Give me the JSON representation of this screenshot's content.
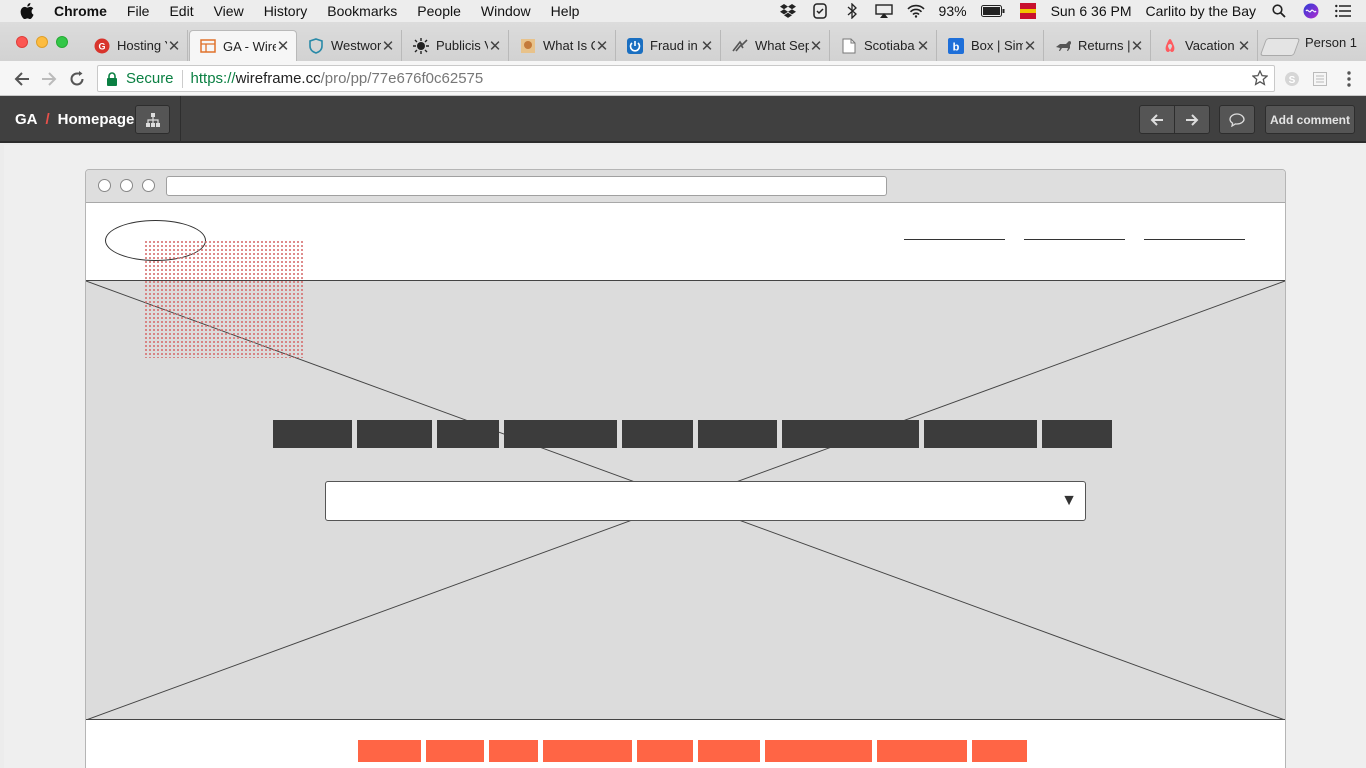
{
  "menubar": {
    "app_name": "Chrome",
    "items": [
      "File",
      "Edit",
      "View",
      "History",
      "Bookmarks",
      "People",
      "Window",
      "Help"
    ],
    "battery": "93%",
    "clock": "Sun 6 36 PM",
    "user": "Carlito by the Bay",
    "icons": [
      "dropbox-icon",
      "check-icon",
      "bluetooth-icon",
      "airplay-icon",
      "wifi-icon",
      "battery-icon",
      "flag-icon",
      "search-icon",
      "siri-icon",
      "list-icon"
    ]
  },
  "tabs": [
    {
      "title": "Hosting Y",
      "icon": "hosting-icon",
      "color": "#d8342c"
    },
    {
      "title": "GA - Wire",
      "icon": "wireframe-icon",
      "color": "#e0722b",
      "active": true
    },
    {
      "title": "Westworl",
      "icon": "shield-icon",
      "color": "#2a8aa8"
    },
    {
      "title": "Publicis V",
      "icon": "sun-icon",
      "color": "#222222"
    },
    {
      "title": "What Is C",
      "icon": "comic-icon",
      "color": "#c47a3a"
    },
    {
      "title": "Fraud in",
      "icon": "power-icon",
      "color": "#1a6fc1"
    },
    {
      "title": "What Sep",
      "icon": "wing-icon",
      "color": "#555555"
    },
    {
      "title": "Scotiaba",
      "icon": "page-icon",
      "color": "#777777"
    },
    {
      "title": "Box | Sim",
      "icon": "box-icon",
      "color": "#1e6fd9"
    },
    {
      "title": "Returns |",
      "icon": "dog-icon",
      "color": "#555555"
    },
    {
      "title": "Vacation",
      "icon": "airbnb-icon",
      "color": "#ff5a5f"
    }
  ],
  "profile_label": "Person 1",
  "omnibox": {
    "secure_label": "Secure",
    "scheme": "https://",
    "host": "wireframe.cc",
    "path": "/pro/pp/77e676f0c62575"
  },
  "appbar": {
    "project": "GA",
    "separator": "/",
    "page": "Homepage",
    "add_comment_label": "Add comment"
  },
  "wireframe": {
    "hero_button_count": 9,
    "footer_button_count": 9,
    "select_caret": "▼",
    "colors": {
      "dark_block": "#3c3c3c",
      "accent_block": "#ff6545",
      "hero_bg": "#dcdcdc",
      "note_dots": "#d56b6b"
    }
  }
}
